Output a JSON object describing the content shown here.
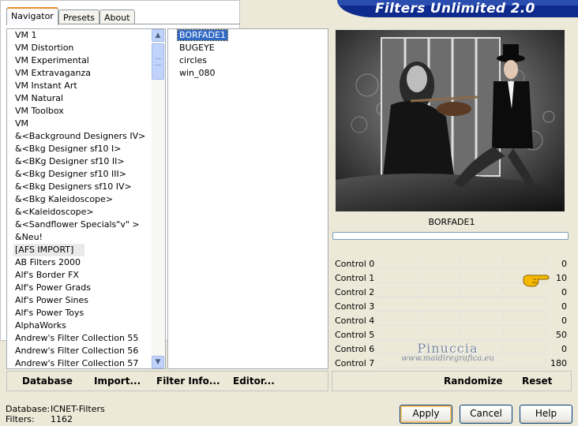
{
  "tabs": [
    {
      "label": "Navigator",
      "active": true
    },
    {
      "label": "Presets"
    },
    {
      "label": "About"
    }
  ],
  "banner_title": "Filters Unlimited 2.0",
  "categories": [
    "VM 1",
    "VM Distortion",
    "VM Experimental",
    "VM Extravaganza",
    "VM Instant Art",
    "VM Natural",
    "VM Toolbox",
    "VM",
    "&<Background Designers IV>",
    "&<Bkg Designer sf10 I>",
    "&<BKg Designer sf10 II>",
    "&<Bkg Designer sf10 III>",
    "&<Bkg Designers sf10 IV>",
    "&<Bkg Kaleidoscope>",
    "&<Kaleidoscope>",
    "&<Sandflower Specials\"v\" >",
    "&Neu!",
    "[AFS IMPORT]",
    "AB Filters 2000",
    "Alf's Border FX",
    "Alf's Power Grads",
    "Alf's Power Sines",
    "Alf's Power Toys",
    "AlphaWorks",
    "Andrew's Filter Collection 55",
    "Andrew's Filter Collection 56",
    "Andrew's Filter Collection 57"
  ],
  "selected_category": "[AFS IMPORT]",
  "filters": [
    "BORFADE1",
    "BUGEYE",
    "circles",
    "win_080"
  ],
  "selected_filter": "BORFADE1",
  "preview_name": "BORFADE1",
  "controls": [
    {
      "label": "Control 0",
      "value": "0"
    },
    {
      "label": "Control 1",
      "value": "10"
    },
    {
      "label": "Control 2",
      "value": "0"
    },
    {
      "label": "Control 3",
      "value": "0"
    },
    {
      "label": "Control 4",
      "value": "0"
    },
    {
      "label": "Control 5",
      "value": "50"
    },
    {
      "label": "Control 6",
      "value": "0"
    },
    {
      "label": "Control 7",
      "value": "180"
    }
  ],
  "watermark": {
    "title": "Pinuccia",
    "url": "www.maidiregrafica.eu"
  },
  "left_bar": {
    "database": "Database",
    "import": "Import...",
    "filter_info": "Filter Info...",
    "editor": "Editor..."
  },
  "right_bar": {
    "randomize": "Randomize",
    "reset": "Reset"
  },
  "info": {
    "database_label": "Database:",
    "database_value": "ICNET-Filters",
    "filters_label": "Filters:",
    "filters_value": "1162"
  },
  "buttons": {
    "apply": "Apply",
    "cancel": "Cancel",
    "help": "Help"
  },
  "icons": {
    "pointer": "pointing-hand-icon",
    "scroll_up": "scroll-up-icon",
    "scroll_down": "scroll-down-icon"
  }
}
